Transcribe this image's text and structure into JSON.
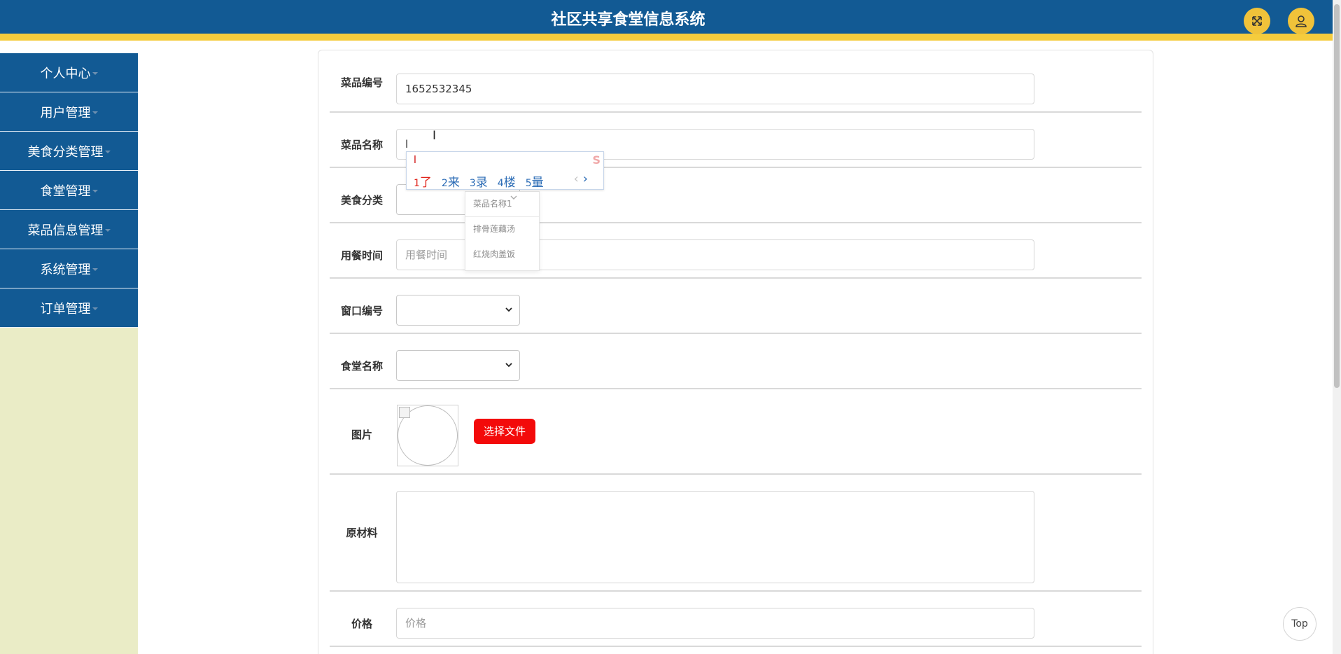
{
  "header": {
    "title": "社区共享食堂信息系统",
    "fullscreen_icon": "expand-arrows-icon",
    "user_icon": "user-icon",
    "accent_color": "#f0c23a",
    "brand_color": "#125a94"
  },
  "sidebar": {
    "items": [
      {
        "label": "个人中心"
      },
      {
        "label": "用户管理"
      },
      {
        "label": "美食分类管理"
      },
      {
        "label": "食堂管理"
      },
      {
        "label": "菜品信息管理"
      },
      {
        "label": "系统管理"
      },
      {
        "label": "订单管理"
      }
    ]
  },
  "form": {
    "dish_no": {
      "label": "菜品编号",
      "value": "1652532345"
    },
    "dish_name": {
      "label": "菜品名称",
      "value": "l"
    },
    "food_category": {
      "label": "美食分类",
      "value": ""
    },
    "meal_time": {
      "label": "用餐时间",
      "placeholder": "用餐时间"
    },
    "window_no": {
      "label": "窗口编号",
      "value": ""
    },
    "canteen_name": {
      "label": "食堂名称",
      "value": ""
    },
    "image": {
      "label": "图片",
      "button_label": "选择文件"
    },
    "ingredients": {
      "label": "原材料",
      "value": ""
    },
    "price": {
      "label": "价格",
      "placeholder": "价格"
    }
  },
  "ime": {
    "composition": "l",
    "candidates": [
      {
        "num": "1",
        "text": "了"
      },
      {
        "num": "2",
        "text": "来"
      },
      {
        "num": "3",
        "text": "录"
      },
      {
        "num": "4",
        "text": "楼"
      },
      {
        "num": "5",
        "text": "量"
      }
    ],
    "prev": "‹",
    "next": "›"
  },
  "autocomplete": {
    "options": [
      "菜品名称1",
      "排骨莲藕汤",
      "红烧肉盖饭"
    ]
  },
  "top_button": {
    "label": "Top"
  }
}
